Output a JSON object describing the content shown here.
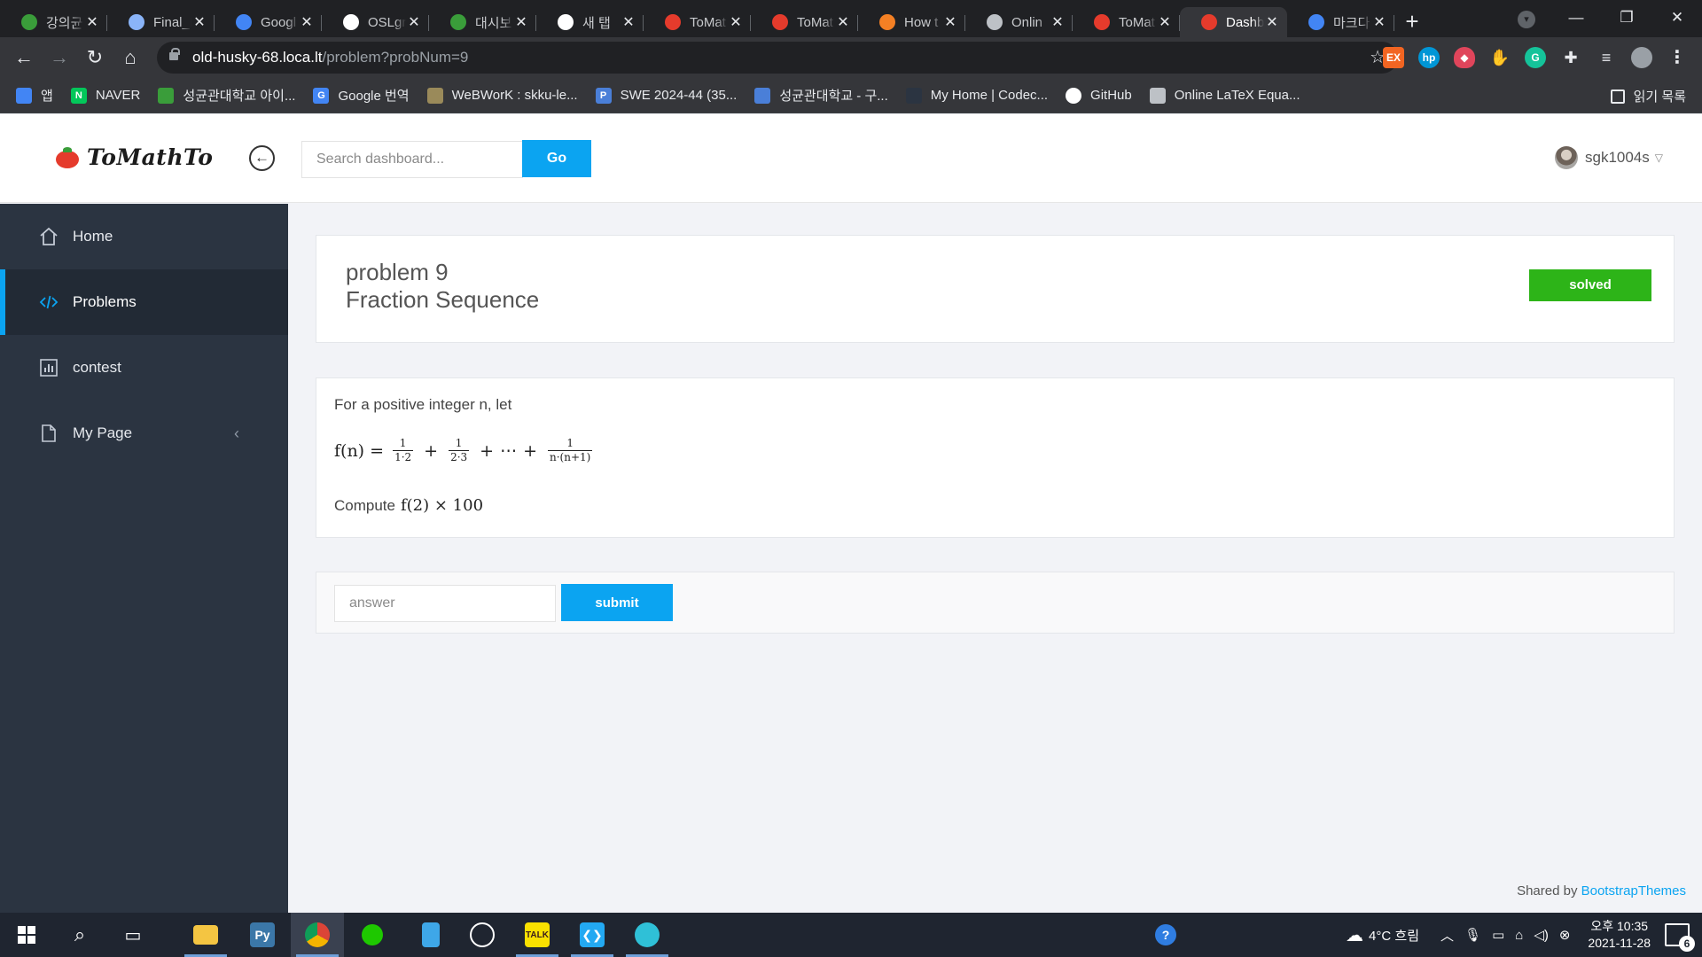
{
  "browser": {
    "tabs": [
      {
        "label": "강의균",
        "favicon_color": "#3a9d3a",
        "favicon": "leaf-icon"
      },
      {
        "label": "Final_I",
        "favicon_color": "#8ab4f8",
        "favicon": "globe-icon"
      },
      {
        "label": "Googl",
        "favicon_color": "#4285f4",
        "favicon": "translate-icon"
      },
      {
        "label": "OSLgr",
        "favicon_color": "#ffffff",
        "favicon": "github-icon"
      },
      {
        "label": "대시보",
        "favicon_color": "#3a9d3a",
        "favicon": "leaf-icon"
      },
      {
        "label": "새 탭",
        "favicon_color": "#ffffff",
        "favicon": "chrome-icon"
      },
      {
        "label": "ToMat",
        "favicon_color": "#e53b2c",
        "favicon": "tomato-icon"
      },
      {
        "label": "ToMat",
        "favicon_color": "#e53b2c",
        "favicon": "tomato-icon"
      },
      {
        "label": "How t",
        "favicon_color": "#f48024",
        "favicon": "stackoverflow-icon"
      },
      {
        "label": "Onlin",
        "favicon_color": "#bdc1c6",
        "favicon": "gear-icon"
      },
      {
        "label": "ToMat",
        "favicon_color": "#e53b2c",
        "favicon": "tomato-icon"
      },
      {
        "label": "Dashb",
        "favicon_color": "#e53b2c",
        "favicon": "tomato-icon",
        "active": true
      },
      {
        "label": "마크다",
        "favicon_color": "#4285f4",
        "favicon": "google-icon"
      }
    ],
    "url_host": "old-husky-68.loca.lt",
    "url_path": "/problem?probNum=9",
    "bookmarks": [
      {
        "label": "앱",
        "color": "#4285f4",
        "icon": "apps-grid-icon"
      },
      {
        "label": "NAVER",
        "color": "#03c75a",
        "icon": "naver-icon",
        "glyph": "N"
      },
      {
        "label": "성균관대학교 아이...",
        "color": "#3a9d3a",
        "icon": "leaf-icon"
      },
      {
        "label": "Google 번역",
        "color": "#4285f4",
        "icon": "translate-icon",
        "glyph": "G"
      },
      {
        "label": "WeBWorK : skku-le...",
        "color": "#9a8a5a",
        "icon": "webwork-icon"
      },
      {
        "label": "SWE 2024-44 (35...",
        "color": "#4a7fd8",
        "icon": "p-icon",
        "glyph": "P"
      },
      {
        "label": "성균관대학교 - 구...",
        "color": "#4a7fd8",
        "icon": "shield-icon"
      },
      {
        "label": "My Home | Codec...",
        "color": "#2b3441",
        "icon": "codecademy-icon"
      },
      {
        "label": "GitHub",
        "color": "#ffffff",
        "icon": "github-icon"
      },
      {
        "label": "Online LaTeX Equa...",
        "color": "#bdc1c6",
        "icon": "gear-icon"
      }
    ],
    "reading_list": "읽기 목록"
  },
  "header": {
    "logo_text": "ToMathTo",
    "search_placeholder": "Search dashboard...",
    "go_label": "Go",
    "username": "sgk1004s"
  },
  "sidebar": {
    "items": [
      {
        "label": "Home",
        "icon": "home-icon"
      },
      {
        "label": "Problems",
        "icon": "code-icon",
        "active": true
      },
      {
        "label": "contest",
        "icon": "bar-chart-icon"
      },
      {
        "label": "My Page",
        "icon": "file-icon"
      }
    ]
  },
  "problem": {
    "number_label": "problem 9",
    "title": "Fraction Sequence",
    "status": "solved",
    "status_color": "#2db418",
    "intro": "For a positive integer n, let",
    "formula_lhs": "f(n) =",
    "fractions": [
      {
        "num": "1",
        "den": "1·2"
      },
      {
        "num": "1",
        "den": "2·3"
      },
      {
        "num": "1",
        "den": "n·(n+1)"
      }
    ],
    "ellipsis": "⋯",
    "compute_label": "Compute",
    "compute_expr": "f(2) × 100"
  },
  "answer": {
    "placeholder": "answer",
    "submit_label": "submit"
  },
  "footer": {
    "prefix": "Shared by ",
    "link": "BootstrapThemes"
  },
  "taskbar": {
    "weather": "4°C 흐림",
    "time": "오후 10:35",
    "date": "2021-11-28",
    "notification_count": "6",
    "accent": "#0ba4f1"
  }
}
